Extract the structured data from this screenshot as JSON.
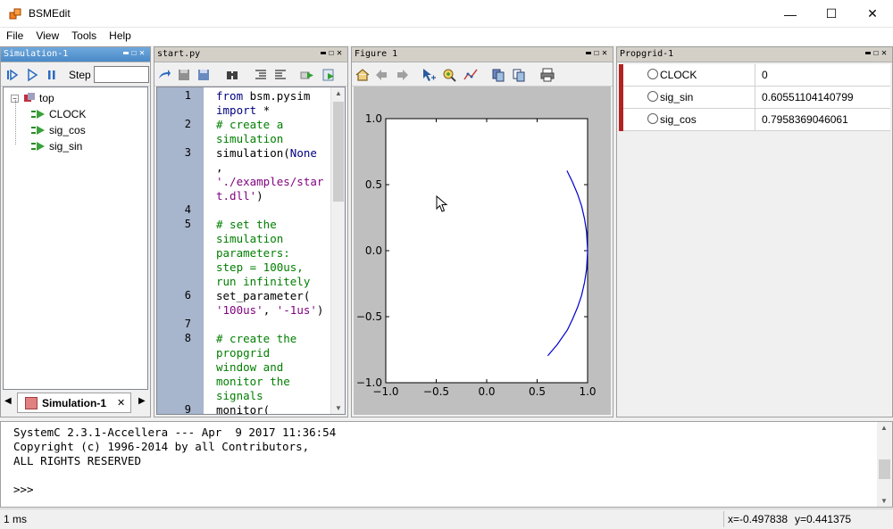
{
  "window": {
    "title": "BSMEdit",
    "minimize": "—",
    "maximize": "☐",
    "close": "✕"
  },
  "menu": [
    "File",
    "View",
    "Tools",
    "Help"
  ],
  "simulation_panel": {
    "title": "Simulation-1",
    "step_label": "Step",
    "step_value": "",
    "tree": {
      "root": "top",
      "children": [
        "CLOCK",
        "sig_cos",
        "sig_sin"
      ]
    },
    "tab_label": "Simulation-1",
    "tab_close": "✕"
  },
  "editor_panel": {
    "title": "start.py",
    "lines": [
      {
        "no": "1",
        "rows": [
          [
            {
              "t": "from ",
              "c": "kw"
            },
            {
              "t": "bsm.pysim",
              "c": ""
            }
          ],
          [
            {
              "t": "import ",
              "c": "kw"
            },
            {
              "t": "*",
              "c": ""
            }
          ]
        ]
      },
      {
        "no": "2",
        "rows": [
          [
            {
              "t": "# create a",
              "c": "cm"
            }
          ],
          [
            {
              "t": "simulation",
              "c": "cm"
            }
          ]
        ]
      },
      {
        "no": "3",
        "rows": [
          [
            {
              "t": "simulation(",
              "c": ""
            },
            {
              "t": "None",
              "c": "kw"
            }
          ],
          [
            {
              "t": ",",
              "c": ""
            }
          ],
          [
            {
              "t": "'./examples/star",
              "c": "st"
            }
          ],
          [
            {
              "t": "t.dll'",
              "c": "st"
            },
            {
              "t": ")",
              "c": ""
            }
          ]
        ]
      },
      {
        "no": "4",
        "rows": [
          [
            {
              "t": "",
              "c": ""
            }
          ]
        ]
      },
      {
        "no": "5",
        "rows": [
          [
            {
              "t": "# set the",
              "c": "cm"
            }
          ],
          [
            {
              "t": "simulation",
              "c": "cm"
            }
          ],
          [
            {
              "t": "parameters:",
              "c": "cm"
            }
          ],
          [
            {
              "t": "step = 100us,",
              "c": "cm"
            }
          ],
          [
            {
              "t": "run infinitely",
              "c": "cm"
            }
          ]
        ]
      },
      {
        "no": "6",
        "rows": [
          [
            {
              "t": "set_parameter(",
              "c": ""
            }
          ],
          [
            {
              "t": "'100us'",
              "c": "st"
            },
            {
              "t": ", ",
              "c": ""
            },
            {
              "t": "'-1us'",
              "c": "st"
            },
            {
              "t": ")",
              "c": ""
            }
          ]
        ]
      },
      {
        "no": "7",
        "rows": [
          [
            {
              "t": "",
              "c": ""
            }
          ]
        ]
      },
      {
        "no": "8",
        "rows": [
          [
            {
              "t": "# create the",
              "c": "cm"
            }
          ],
          [
            {
              "t": "propgrid",
              "c": "cm"
            }
          ],
          [
            {
              "t": "window and",
              "c": "cm"
            }
          ],
          [
            {
              "t": "monitor the",
              "c": "cm"
            }
          ],
          [
            {
              "t": "signals",
              "c": "cm"
            }
          ]
        ]
      },
      {
        "no": "9",
        "rows": [
          [
            {
              "t": "monitor(",
              "c": ""
            }
          ]
        ]
      }
    ]
  },
  "figure_panel": {
    "title": "Figure 1"
  },
  "chart_data": {
    "type": "line",
    "title": "",
    "xlabel": "",
    "ylabel": "",
    "xlim": [
      -1.0,
      1.0
    ],
    "ylim": [
      -1.0,
      1.0
    ],
    "xticks": [
      "−1.0",
      "−0.5",
      "0.0",
      "0.5",
      "1.0"
    ],
    "yticks": [
      "1.0",
      "0.5",
      "0.0",
      "−0.5",
      "−1.0"
    ],
    "grid": false,
    "series": [
      {
        "color": "#0000cc",
        "x": [
          0.7958,
          0.85,
          0.9,
          0.94,
          0.97,
          0.99,
          1.0,
          0.99,
          0.97,
          0.94,
          0.9,
          0.85,
          0.8,
          0.7,
          0.6055
        ],
        "y": [
          0.6055,
          0.52,
          0.43,
          0.34,
          0.24,
          0.14,
          0.0,
          -0.14,
          -0.24,
          -0.34,
          -0.43,
          -0.52,
          -0.6,
          -0.71,
          -0.7958
        ]
      }
    ]
  },
  "propgrid_panel": {
    "title": "Propgrid-1",
    "rows": [
      {
        "name": "CLOCK",
        "value": "0"
      },
      {
        "name": "sig_sin",
        "value": "0.60551104140799"
      },
      {
        "name": "sig_cos",
        "value": "0.7958369046061"
      }
    ],
    "marker_color": "#b22222"
  },
  "console": {
    "lines": [
      "SystemC 2.3.1-Accellera --- Apr  9 2017 11:36:54",
      "Copyright (c) 1996-2014 by all Contributors,",
      "ALL RIGHTS RESERVED",
      "",
      ">>>"
    ]
  },
  "statusbar": {
    "time": "1 ms",
    "coord_x": "x=-0.497838",
    "coord_y": "y=0.441375"
  }
}
